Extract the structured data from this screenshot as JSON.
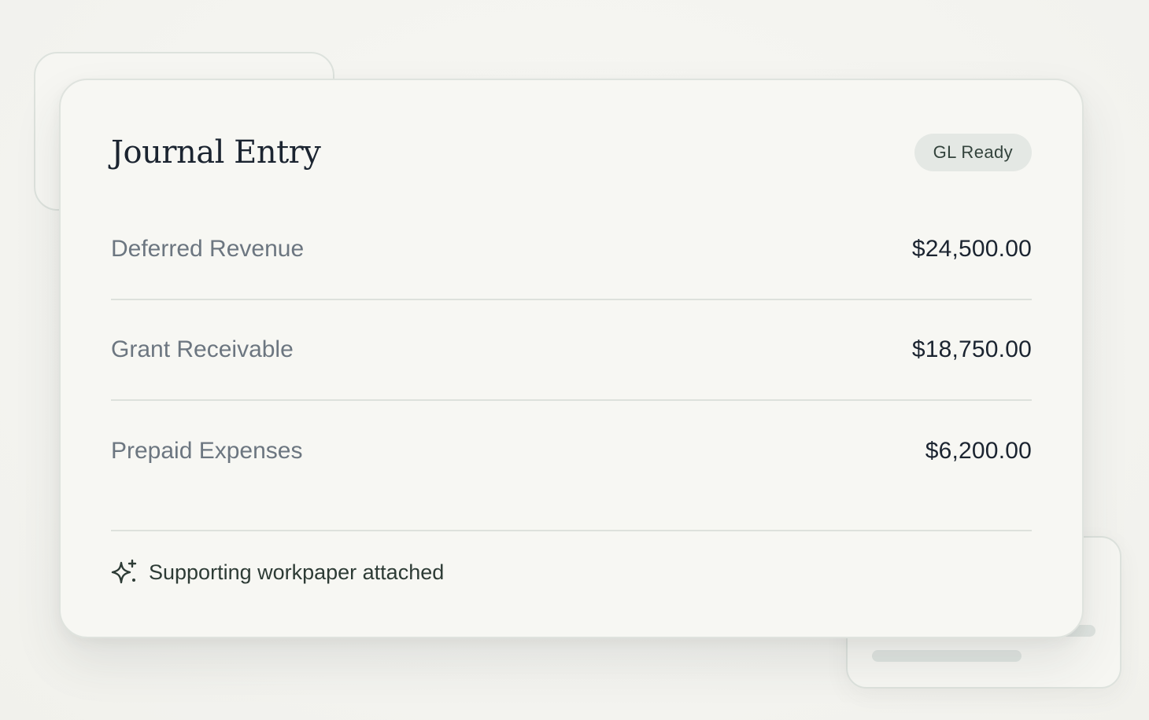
{
  "card": {
    "title": "Journal Entry",
    "badge": "GL Ready"
  },
  "entries": [
    {
      "label": "Deferred Revenue",
      "amount": "$24,500.00"
    },
    {
      "label": "Grant Receivable",
      "amount": "$18,750.00"
    },
    {
      "label": "Prepaid Expenses",
      "amount": "$6,200.00"
    }
  ],
  "footer": {
    "icon": "sparkle-icon",
    "text": "Supporting workpaper attached"
  },
  "colors": {
    "accent": "#33433c",
    "badge_bg": "#e4e8e4",
    "text_primary": "#1b2430",
    "text_muted": "#6c7680"
  }
}
